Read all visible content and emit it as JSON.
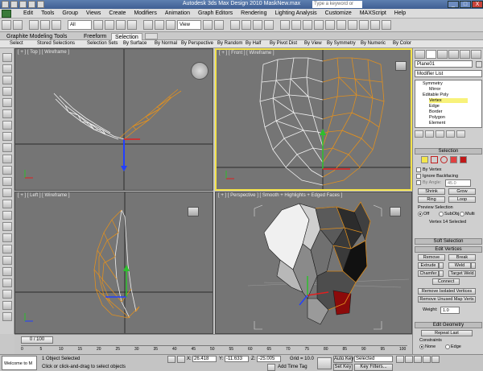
{
  "window": {
    "title": "Autodesk 3ds Max Design 2010      MaskNew.max",
    "search_placeholder": "Type a keyword or phrase",
    "buttons": [
      "_",
      "□",
      "X"
    ]
  },
  "menu": {
    "items": [
      "Edit",
      "Tools",
      "Group",
      "Views",
      "Create",
      "Modifiers",
      "Animation",
      "Graph Editors",
      "Rendering",
      "Lighting Analysis",
      "Customize",
      "MAXScript",
      "Help"
    ]
  },
  "toolbar": {
    "selection_filter": "All",
    "view_dropdown": "View"
  },
  "ribbon": {
    "tabs": [
      "Graphite Modeling Tools",
      "Freeform",
      "Selection"
    ],
    "active_tab": "Selection",
    "row": [
      "Select",
      "Stored Selections",
      "Selection Sets",
      "By Surface",
      "By Normal",
      "By Perspective",
      "By Random",
      "By Half",
      "By Pivot Dist",
      "By View",
      "By Symmetry",
      "By Numeric",
      "By Color"
    ]
  },
  "viewports": {
    "top": "[ + ] [ Top ] [ Wireframe ]",
    "front": "[ + ] [ Front ] [ Wireframe ]",
    "left": "[ + ] [ Left ] [ Wireframe ]",
    "perspective": "[ + ] [ Perspective ] [ Smooth + Highlights + Edged Faces ]"
  },
  "command_panel": {
    "object_name": "Plane01",
    "modifier_list": "Modifier List",
    "stack": [
      "Symmetry",
      "Mirror",
      "Editable Poly",
      "Vertex",
      "Edge",
      "Border",
      "Polygon",
      "Element"
    ],
    "selected_stack_item": "Vertex",
    "selection": {
      "title": "Selection",
      "by_vertex": "By Vertex",
      "ignore_backfacing": "Ignore Backfacing",
      "by_angle": "By Angle:",
      "by_angle_value": "45.0",
      "shrink": "Shrink",
      "grow": "Grow",
      "ring": "Ring",
      "loop": "Loop",
      "preview_selection": "Preview Selection",
      "preview_options": [
        "Off",
        "SubObj",
        "Multi"
      ],
      "status": "Vertex 14 Selected"
    },
    "soft_selection": "Soft Selection",
    "edit_vertices": {
      "title": "Edit Vertices",
      "remove": "Remove",
      "break": "Break",
      "extrude": "Extrude",
      "weld": "Weld",
      "chamfer": "Chamfer",
      "target_weld": "Target Weld",
      "connect": "Connect",
      "remove_isolated": "Remove Isolated Vertices",
      "remove_unused": "Remove Unused Map Verts",
      "weight_label": "Weight:",
      "weight_value": "1.0"
    },
    "edit_geometry": {
      "title": "Edit Geometry",
      "repeat_last": "Repeat Last",
      "constraints": "Constraints",
      "none": "None",
      "edge": "Edge"
    }
  },
  "timeline": {
    "slider": "0 / 100",
    "ticks": [
      "0",
      "5",
      "10",
      "15",
      "20",
      "25",
      "30",
      "35",
      "40",
      "45",
      "50",
      "55",
      "60",
      "65",
      "70",
      "75",
      "80",
      "85",
      "90",
      "95",
      "100"
    ]
  },
  "status": {
    "maxscript": "Welcome to M",
    "selection": "1 Object Selected",
    "prompt": "Click or click-and-drag to select objects",
    "x_label": "X:",
    "x_value": "26.418",
    "y_label": "Y:",
    "y_value": "-11.633",
    "z_label": "Z:",
    "z_value": "-25.005",
    "grid": "Grid = 10.0",
    "add_time_tag": "Add Time Tag",
    "auto_key": "Auto Key",
    "set_key": "Set Key",
    "key_selected": "Selected",
    "key_filters": "Key Filters..."
  },
  "colors": {
    "active_viewport_border": "#f3e24a",
    "selected_vertex": "#e09020",
    "viewport_bg": "#757575"
  }
}
